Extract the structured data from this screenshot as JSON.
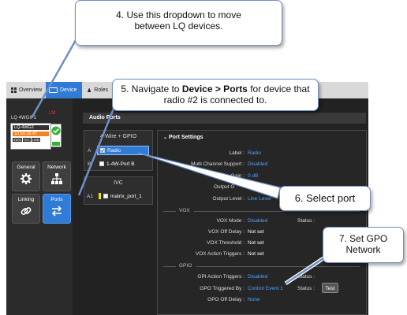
{
  "tabs": [
    {
      "label": "Overview"
    },
    {
      "label": "Device"
    },
    {
      "label": "Roles"
    }
  ],
  "device": {
    "name": "LQ 4WGIF1",
    "indicator": "LM",
    "box_lines": [
      "LQ-4WG2",
      "10.50.16.47"
    ],
    "badges": [
      "4WG",
      "IVC",
      "USB"
    ]
  },
  "nav_buttons": [
    {
      "label": "General",
      "icon": "gear-icon"
    },
    {
      "label": "Network",
      "icon": "network-icon"
    },
    {
      "label": "Linking",
      "icon": "link-icon"
    },
    {
      "label": "Ports",
      "icon": "arrows-icon"
    }
  ],
  "audio_ports_header": "Audio Ports",
  "gpio_panel": {
    "title": "4-Wire + GPIO",
    "ports": [
      {
        "letter": "A",
        "label": "Radio"
      },
      {
        "letter": "B",
        "label": "1-4W-Port B"
      }
    ]
  },
  "ivc_panel": {
    "title": "IVC",
    "ports": [
      {
        "letter": "A1",
        "label": "matrix_port_1"
      }
    ]
  },
  "port_settings": {
    "title": "Port Settings",
    "rows": [
      {
        "label": "Label :",
        "value": "Radio"
      },
      {
        "label": "Multi Channel Support :",
        "value": "Disabled"
      },
      {
        "label": "Gain :",
        "value": "0 dB"
      },
      {
        "label": "Output G",
        "value": ""
      },
      {
        "label": "Output Level :",
        "value": "Line Level"
      }
    ],
    "vox_section": "VOX",
    "vox_rows": [
      {
        "label": "VOX Mode :",
        "value": "Disabled",
        "status": "Status :"
      },
      {
        "label": "VOX Off Delay :",
        "value": "Not set"
      },
      {
        "label": "VOX Threshold :",
        "value": "Not set"
      },
      {
        "label": "VOX Action Triggers :",
        "value": "Not set"
      }
    ],
    "gpio_section": "GPIO",
    "gpio_rows": [
      {
        "label": "GPI Action Triggers :",
        "value": "Disabled",
        "status": "Status :"
      },
      {
        "label": "GPO Triggered By :",
        "value": "Control Event 1",
        "status": "Status :",
        "button": "Test"
      },
      {
        "label": "GPO Off Delay :",
        "value": "None"
      }
    ]
  },
  "callouts": {
    "c4": "4. Use this dropdown to move between LQ devices.",
    "c5_prefix": "5. Navigate to ",
    "c5_bold": "Device > Ports",
    "c5_suffix": " for device that radio #2 is connected to.",
    "c6": "6. Select port",
    "c7": "7. Set GPO Network"
  },
  "colors": {
    "accent": "#2f7bd6",
    "link": "#4aa3ff",
    "status_green": "#34b233",
    "time_orange": "#f58220",
    "indicator_red": "#e03a2f"
  }
}
